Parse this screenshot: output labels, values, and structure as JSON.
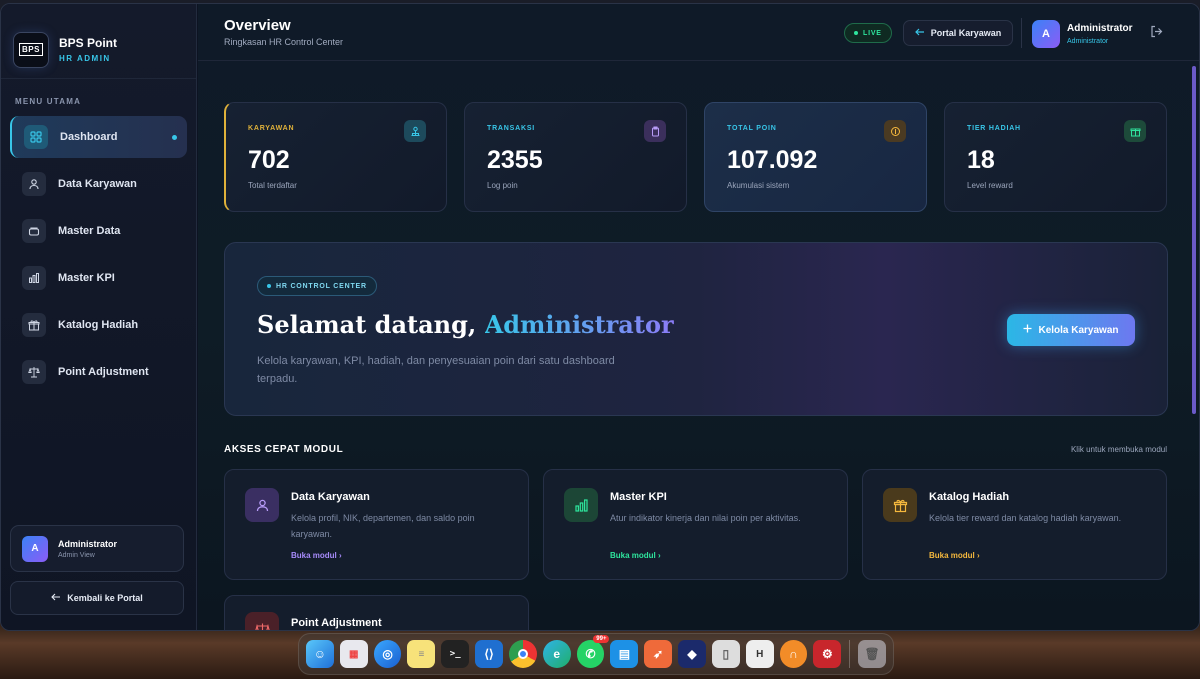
{
  "brand": {
    "name": "BPS Point",
    "sub": "HR ADMIN",
    "logo_text": "BPS"
  },
  "sidebar": {
    "menu_title": "MENU UTAMA",
    "items": [
      {
        "label": "Dashboard",
        "icon": "grid-icon"
      },
      {
        "label": "Data Karyawan",
        "icon": "users-icon"
      },
      {
        "label": "Master Data",
        "icon": "database-icon"
      },
      {
        "label": "Master KPI",
        "icon": "bar-chart-icon"
      },
      {
        "label": "Katalog Hadiah",
        "icon": "gift-icon"
      },
      {
        "label": "Point Adjustment",
        "icon": "scale-icon"
      }
    ],
    "user": {
      "avatar": "A",
      "name": "Administrator",
      "role": "Admin View"
    },
    "back_label": "Kembali ke Portal"
  },
  "header": {
    "title": "Overview",
    "subtitle": "Ringkasan HR Control Center",
    "live": "LIVE",
    "portal_button": "Portal Karyawan",
    "user": {
      "avatar": "A",
      "name": "Administrator",
      "role": "Administrator"
    }
  },
  "stats": [
    {
      "label": "KARYAWAN",
      "value": "702",
      "desc": "Total terdaftar",
      "color": "#e0b23a"
    },
    {
      "label": "TRANSAKSI",
      "value": "2355",
      "desc": "Log poin",
      "color": "#38c6e8"
    },
    {
      "label": "TOTAL POIN",
      "value": "107.092",
      "desc": "Akumulasi sistem",
      "color": "#38c6e8"
    },
    {
      "label": "TIER HADIAH",
      "value": "18",
      "desc": "Level reward",
      "color": "#38c6e8"
    }
  ],
  "hero": {
    "badge": "HR CONTROL CENTER",
    "title_prefix": "Selamat datang, ",
    "title_name": "Administrator",
    "desc": "Kelola karyawan, KPI, hadiah, dan penyesuaian poin dari satu dashboard terpadu.",
    "button": "Kelola Karyawan"
  },
  "quick": {
    "title": "AKSES CEPAT MODUL",
    "hint": "Klik untuk membuka modul",
    "link_label": "Buka modul",
    "modules": [
      {
        "title": "Data Karyawan",
        "desc": "Kelola profil, NIK, departemen, dan saldo poin karyawan.",
        "color": "#a78bfa"
      },
      {
        "title": "Master KPI",
        "desc": "Atur indikator kinerja dan nilai poin per aktivitas.",
        "color": "#2ee59d"
      },
      {
        "title": "Katalog Hadiah",
        "desc": "Kelola tier reward dan katalog hadiah karyawan.",
        "color": "#f5b83d"
      },
      {
        "title": "Point Adjustment",
        "desc": "",
        "color": "#f06a6a"
      }
    ]
  },
  "dock": {
    "badge": "99+"
  }
}
